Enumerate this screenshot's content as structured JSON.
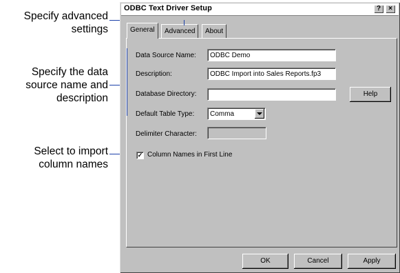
{
  "callouts": [
    {
      "lines": [
        "Specify advanced",
        "settings"
      ]
    },
    {
      "lines": [
        "Specify the data",
        "source name and",
        "description"
      ]
    },
    {
      "lines": [
        "Select to import",
        "column names"
      ]
    }
  ],
  "dialog": {
    "title": "ODBC Text Driver Setup",
    "help_glyph": "?",
    "close_glyph": "×",
    "tabs": [
      "General",
      "Advanced",
      "About"
    ],
    "fields": {
      "data_source_name": {
        "label": "Data Source Name:",
        "value": "ODBC Demo"
      },
      "description": {
        "label": "Description:",
        "value": "ODBC Import into Sales Reports.fp3"
      },
      "database_directory": {
        "label": "Database Directory:",
        "value": ""
      },
      "default_table_type": {
        "label": "Default Table Type:",
        "value": "Comma"
      },
      "delimiter_character": {
        "label": "Delimiter Character:",
        "value": ""
      }
    },
    "checkbox": {
      "label": "Column Names in First Line",
      "checked": true,
      "mark": "✓"
    },
    "buttons": {
      "help": "Help",
      "ok": "OK",
      "cancel": "Cancel",
      "apply": "Apply"
    }
  }
}
